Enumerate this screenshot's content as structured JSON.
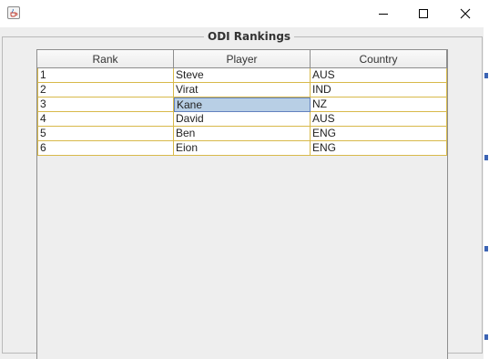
{
  "window": {
    "icon": "java-cup-icon",
    "controls": [
      "minimize-icon",
      "maximize-icon",
      "close-icon"
    ]
  },
  "panel": {
    "title": "ODI Rankings"
  },
  "table": {
    "columns": [
      "Rank",
      "Player",
      "Country"
    ],
    "rows": [
      [
        "1",
        "Steve",
        "AUS"
      ],
      [
        "2",
        "Virat",
        "IND"
      ],
      [
        "3",
        "Kane",
        "NZ"
      ],
      [
        "4",
        "David",
        "AUS"
      ],
      [
        "5",
        "Ben",
        "ENG"
      ],
      [
        "6",
        "Eion",
        "ENG"
      ]
    ],
    "selected_row": 2,
    "selected_column": 1,
    "colors": {
      "grid": "#d8b94a",
      "selection": "#b8cfe5",
      "selection_border": "#6382bf"
    }
  }
}
